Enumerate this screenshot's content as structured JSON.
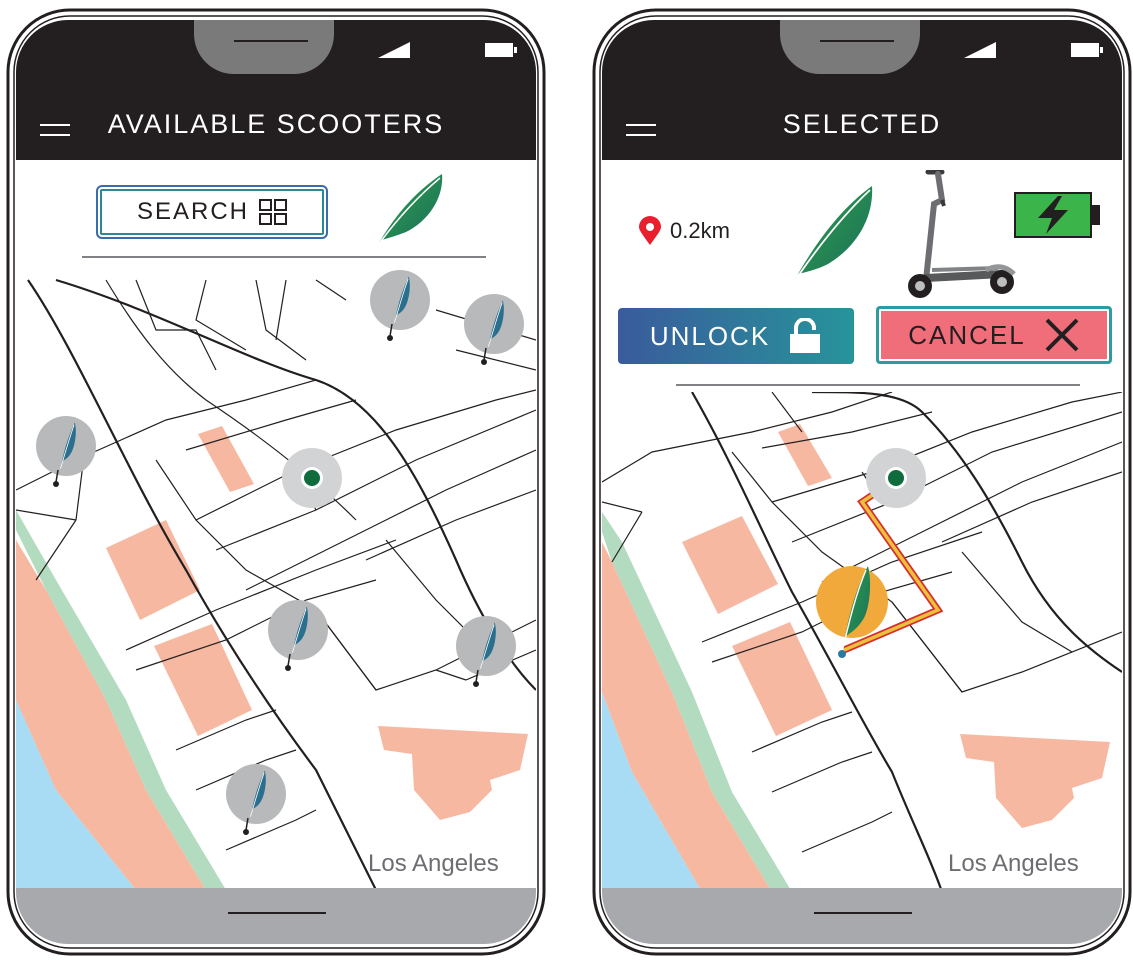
{
  "screens": {
    "available": {
      "title": "AVAILABLE SCOOTERS",
      "search_label": "SEARCH",
      "city_label": "Los Angeles"
    },
    "selected": {
      "title": "SELECTED",
      "distance": "0.2km",
      "unlock_label": "UNLOCK",
      "cancel_label": "CANCEL",
      "city_label": "Los Angeles"
    }
  },
  "icons": {
    "menu": "hamburger-menu-icon",
    "grid": "grid-icon",
    "feather": "feather-icon",
    "location": "location-pin-icon",
    "battery": "battery-charging-icon",
    "lock": "unlock-icon",
    "close": "close-icon",
    "scooter": "scooter-icon"
  },
  "colors": {
    "header": "#231f20",
    "feather": "#1f8a57",
    "unlock_start": "#3a5b9c",
    "unlock_end": "#27949a",
    "cancel": "#ef6e79",
    "marker_bg": "#b8b9bb",
    "selected_marker": "#f2a93b",
    "route": "#e9c23c",
    "route_outline": "#d92e2e",
    "location_pin": "#e8202e",
    "battery": "#3bb54a",
    "building": "#f7b8a2",
    "water": "#a7dcf4",
    "park": "#b3dbc0"
  }
}
